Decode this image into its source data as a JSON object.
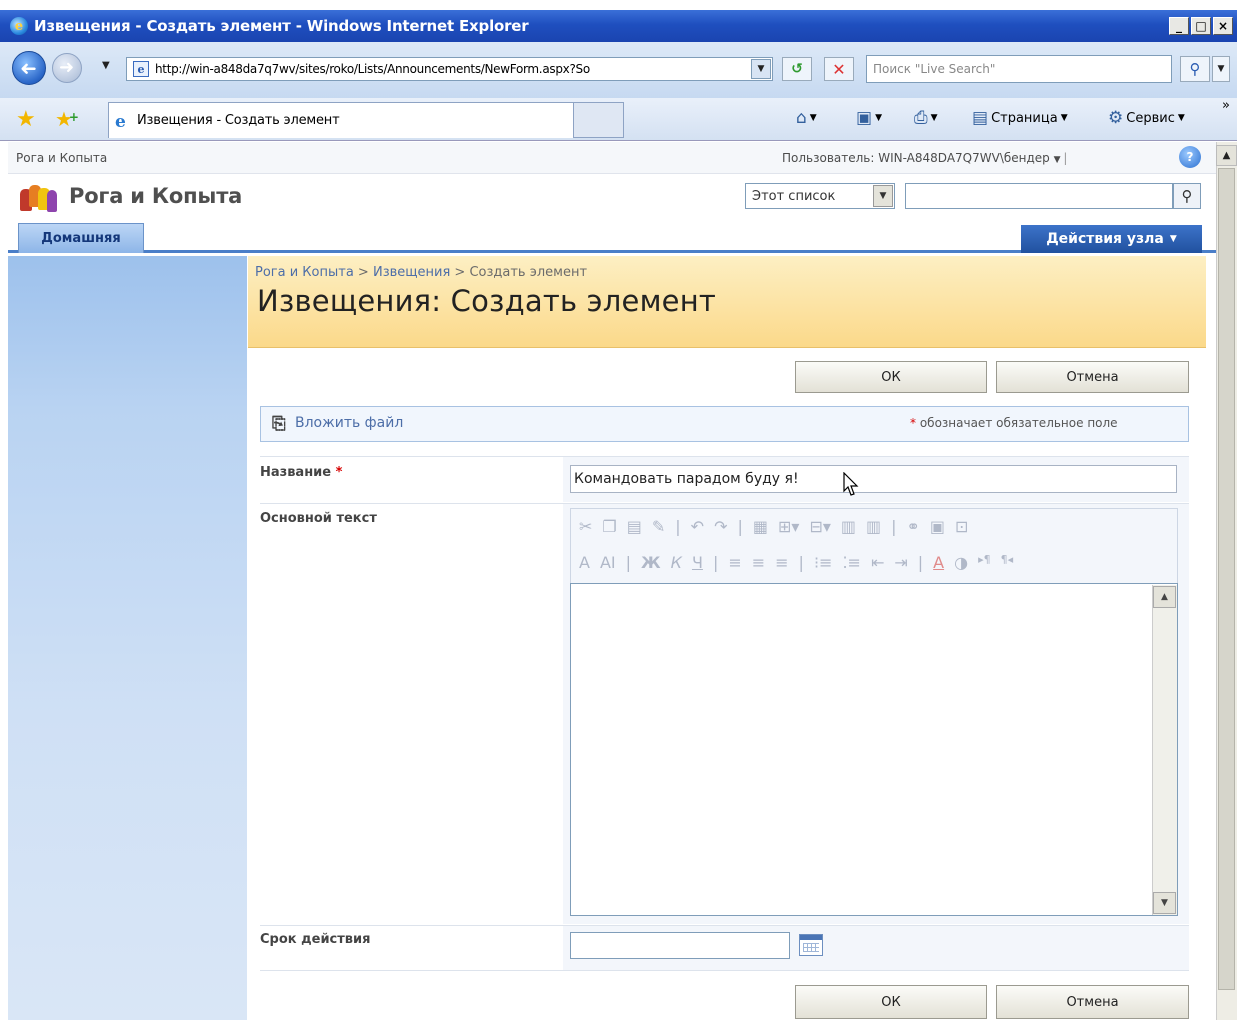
{
  "window": {
    "title": "Извещения - Создать элемент - Windows Internet Explorer",
    "minimize": "_",
    "maximize": "□",
    "close": "×"
  },
  "address_bar": {
    "url": "http://win-a848da7q7wv/sites/roko/Lists/Announcements/NewForm.aspx?So",
    "search_placeholder": "Поиск \"Live Search\""
  },
  "tab_bar": {
    "tab_label": "Извещения - Создать элемент",
    "page_menu": "Страница",
    "tools_menu": "Сервис",
    "overflow": "»"
  },
  "sharepoint": {
    "top_breadcrumb": "Рога и Копыта",
    "user": "Пользователь: WIN-A848DA7Q7WV\\бендер",
    "site_title": "Рога и Копыта",
    "search_scope": "Этот список",
    "home_tab": "Домашняя",
    "site_actions": "Действия узла",
    "breadcrumb": {
      "site": "Рога и Копыта",
      "sep1": " > ",
      "list": "Извещения",
      "sep2": " > ",
      "current": "Создать элемент"
    },
    "page_title": "Извещения: Создать элемент"
  },
  "form": {
    "ok_label": "ОК",
    "cancel_label": "Отмена",
    "attach_file": "Вложить файл",
    "required_note": "обозначает обязательное поле",
    "required_star": "*",
    "fields": {
      "title_label": "Название",
      "title_value": "Командовать парадом буду я!",
      "body_label": "Основной текст",
      "expires_label": "Срок действия"
    }
  },
  "colors": {
    "header_gradient_top": "#fdefc3",
    "header_gradient_bottom": "#fbd98a",
    "link": "#4d6ea8",
    "site_actions_bg": "#21519f",
    "required": "#d60000"
  }
}
